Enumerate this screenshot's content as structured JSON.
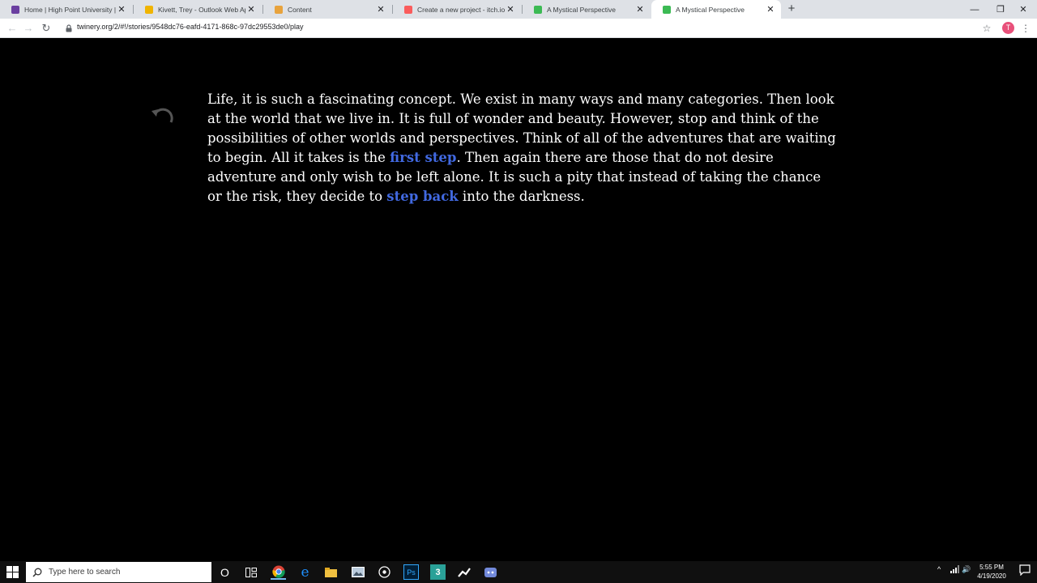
{
  "browser": {
    "tabs": [
      {
        "title": "Home | High Point University | Hi",
        "favicon": "hpu-icon",
        "color": "#6a3fa0"
      },
      {
        "title": "Kivett, Trey - Outlook Web App",
        "favicon": "outlook-icon",
        "color": "#f0b400"
      },
      {
        "title": "Content",
        "favicon": "content-icon",
        "color": "#e8a33d"
      },
      {
        "title": "Create a new project - itch.io",
        "favicon": "itch-icon",
        "color": "#fa5c5c"
      },
      {
        "title": "A Mystical Perspective",
        "favicon": "twine-icon",
        "color": "#3cba54"
      },
      {
        "title": "A Mystical Perspective",
        "favicon": "twine-icon",
        "color": "#3cba54",
        "active": true
      }
    ],
    "new_tab": "+",
    "window": {
      "minimize": "—",
      "restore": "❐",
      "close": "✕"
    },
    "nav": {
      "back": "←",
      "forward": "→",
      "reload": "↻"
    },
    "url": "twinery.org/2/#!/stories/9548dc76-eafd-4171-868c-97dc29553de0/play",
    "bookmark": "☆",
    "profile_initial": "T",
    "menu": "⋮"
  },
  "story": {
    "undo_icon": "undo-icon",
    "text_1": "Life, it is such a fascinating concept. We exist in many ways and many categories. Then look at the world that we live in. It is full of wonder and beauty. However, stop and think of the possibilities of other worlds and perspectives. Think of all of the adventures that are waiting to begin. All it takes is the ",
    "link_1": "first step",
    "text_2": ". Then again there are those that do not desire adventure and only wish to be left alone. It is such a pity that instead of taking the chance or the risk, they decide to ",
    "link_2": "step back",
    "text_3": " into the darkness.",
    "link_color": "#4169e1"
  },
  "taskbar": {
    "search_placeholder": "Type here to search",
    "cortana": "O",
    "photoshop": "Ps",
    "app3": "3",
    "tray_chevron": "^",
    "tray_volume": "🔊",
    "time": "5:55 PM",
    "date": "4/19/2020",
    "notification_count": "2"
  }
}
